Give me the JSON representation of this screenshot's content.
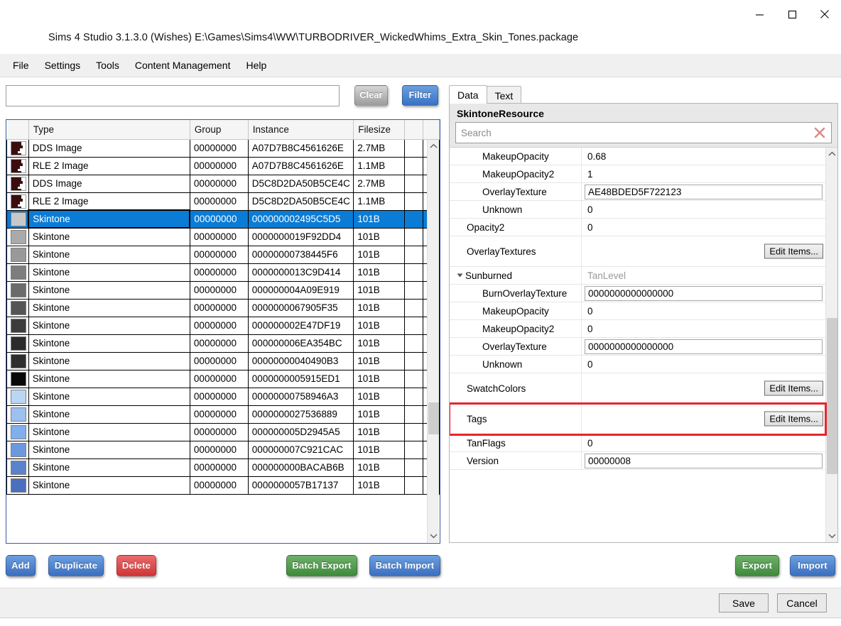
{
  "window": {
    "title": "Sims 4 Studio 3.1.3.0 (Wishes)  E:\\Games\\Sims4\\WW\\TURBODRIVER_WickedWhims_Extra_Skin_Tones.package",
    "minimize_label": "Minimize",
    "maximize_label": "Maximize",
    "close_label": "Close"
  },
  "menu": {
    "items": [
      {
        "label": "File"
      },
      {
        "label": "Settings"
      },
      {
        "label": "Tools"
      },
      {
        "label": "Content Management"
      },
      {
        "label": "Help"
      }
    ]
  },
  "filter": {
    "input_value": "",
    "input_placeholder": "",
    "clear_label": "Clear",
    "filter_label": "Filter"
  },
  "resource_table": {
    "columns": [
      "",
      "Type",
      "Group",
      "Instance",
      "Filesize",
      "",
      ""
    ],
    "rows": [
      {
        "icon": "dds-thumb",
        "color": "#3b0d10",
        "type": "DDS Image",
        "group": "00000000",
        "instance": "A07D7B8C4561626E",
        "filesize": "2.7MB",
        "selected": false
      },
      {
        "icon": "dds-thumb",
        "color": "#3b0d10",
        "type": "RLE 2 Image",
        "group": "00000000",
        "instance": "A07D7B8C4561626E",
        "filesize": "1.1MB",
        "selected": false
      },
      {
        "icon": "dds-thumb",
        "color": "#3b0d10",
        "type": "DDS Image",
        "group": "00000000",
        "instance": "D5C8D2DA50B5CE4C",
        "filesize": "2.7MB",
        "selected": false
      },
      {
        "icon": "dds-thumb",
        "color": "#3b0d10",
        "type": "RLE 2 Image",
        "group": "00000000",
        "instance": "D5C8D2DA50B5CE4C",
        "filesize": "1.1MB",
        "selected": false
      },
      {
        "icon": "swatch",
        "color": "#c8c8c8",
        "type": "Skintone",
        "group": "00000000",
        "instance": "000000002495C5D5",
        "filesize": "101B",
        "selected": true
      },
      {
        "icon": "swatch",
        "color": "#aaaaaa",
        "type": "Skintone",
        "group": "00000000",
        "instance": "0000000019F92DD4",
        "filesize": "101B",
        "selected": false
      },
      {
        "icon": "swatch",
        "color": "#999999",
        "type": "Skintone",
        "group": "00000000",
        "instance": "00000000738445F6",
        "filesize": "101B",
        "selected": false
      },
      {
        "icon": "swatch",
        "color": "#7d7d7d",
        "type": "Skintone",
        "group": "00000000",
        "instance": "0000000013C9D414",
        "filesize": "101B",
        "selected": false
      },
      {
        "icon": "swatch",
        "color": "#6b6b6b",
        "type": "Skintone",
        "group": "00000000",
        "instance": "000000004A09E919",
        "filesize": "101B",
        "selected": false
      },
      {
        "icon": "swatch",
        "color": "#555555",
        "type": "Skintone",
        "group": "00000000",
        "instance": "0000000067905F35",
        "filesize": "101B",
        "selected": false
      },
      {
        "icon": "swatch",
        "color": "#3c3c3c",
        "type": "Skintone",
        "group": "00000000",
        "instance": "000000002E47DF19",
        "filesize": "101B",
        "selected": false
      },
      {
        "icon": "swatch",
        "color": "#2b2b2b",
        "type": "Skintone",
        "group": "00000000",
        "instance": "000000006EA354BC",
        "filesize": "101B",
        "selected": false
      },
      {
        "icon": "swatch",
        "color": "#2e2e2e",
        "type": "Skintone",
        "group": "00000000",
        "instance": "00000000040490B3",
        "filesize": "101B",
        "selected": false
      },
      {
        "icon": "swatch",
        "color": "#080808",
        "type": "Skintone",
        "group": "00000000",
        "instance": "0000000005915ED1",
        "filesize": "101B",
        "selected": false
      },
      {
        "icon": "swatch",
        "color": "#bbd6f5",
        "type": "Skintone",
        "group": "00000000",
        "instance": "00000000758946A3",
        "filesize": "101B",
        "selected": false
      },
      {
        "icon": "swatch",
        "color": "#9cc0ef",
        "type": "Skintone",
        "group": "00000000",
        "instance": "0000000027536889",
        "filesize": "101B",
        "selected": false
      },
      {
        "icon": "swatch",
        "color": "#82aeec",
        "type": "Skintone",
        "group": "00000000",
        "instance": "000000005D2945A5",
        "filesize": "101B",
        "selected": false
      },
      {
        "icon": "swatch",
        "color": "#6c98de",
        "type": "Skintone",
        "group": "00000000",
        "instance": "000000007C921CAC",
        "filesize": "101B",
        "selected": false
      },
      {
        "icon": "swatch",
        "color": "#5a82cd",
        "type": "Skintone",
        "group": "00000000",
        "instance": "000000000BACAB6B",
        "filesize": "101B",
        "selected": false
      },
      {
        "icon": "swatch",
        "color": "#4a6fbe",
        "type": "Skintone",
        "group": "00000000",
        "instance": "0000000057B17137",
        "filesize": "101B",
        "selected": false
      }
    ]
  },
  "details": {
    "tabs": [
      {
        "label": "Data",
        "active": true
      },
      {
        "label": "Text",
        "active": false
      }
    ],
    "resource_title": "SkintoneResource",
    "search": {
      "value": "",
      "placeholder": "Search",
      "clear_icon": "clear-x-icon"
    },
    "edit_items_label": "Edit Items...",
    "properties": [
      {
        "name": "MakeupOpacity",
        "indent": 2,
        "value": "0.68",
        "kind": "text"
      },
      {
        "name": "MakeupOpacity2",
        "indent": 2,
        "value": "1",
        "kind": "text"
      },
      {
        "name": "OverlayTexture",
        "indent": 2,
        "value": "AE48BDED5F722123",
        "kind": "input"
      },
      {
        "name": "Unknown",
        "indent": 2,
        "value": "0",
        "kind": "text"
      },
      {
        "name": "Opacity2",
        "indent": 1,
        "value": "0",
        "kind": "text"
      },
      {
        "name": "OverlayTextures",
        "indent": 1,
        "value": "",
        "kind": "button",
        "tall": true
      },
      {
        "name": "Sunburned",
        "indent": 1,
        "value": "TanLevel",
        "kind": "grey",
        "expander": true
      },
      {
        "name": "BurnOverlayTexture",
        "indent": 2,
        "value": "0000000000000000",
        "kind": "input"
      },
      {
        "name": "MakeupOpacity",
        "indent": 2,
        "value": "0",
        "kind": "text"
      },
      {
        "name": "MakeupOpacity2",
        "indent": 2,
        "value": "0",
        "kind": "text"
      },
      {
        "name": "OverlayTexture",
        "indent": 2,
        "value": "0000000000000000",
        "kind": "input"
      },
      {
        "name": "Unknown",
        "indent": 2,
        "value": "0",
        "kind": "text"
      },
      {
        "name": "SwatchColors",
        "indent": 1,
        "value": "",
        "kind": "button",
        "tall": true
      },
      {
        "name": "Tags",
        "indent": 1,
        "value": "",
        "kind": "button",
        "tall": true,
        "highlighted": true
      },
      {
        "name": "TanFlags",
        "indent": 1,
        "value": "0",
        "kind": "text"
      },
      {
        "name": "Version",
        "indent": 1,
        "value": "00000008",
        "kind": "input"
      }
    ]
  },
  "actions": {
    "add_label": "Add",
    "duplicate_label": "Duplicate",
    "delete_label": "Delete",
    "batch_export_label": "Batch Export",
    "batch_import_label": "Batch Import",
    "export_label": "Export",
    "import_label": "Import"
  },
  "statusbar": {
    "save_label": "Save",
    "cancel_label": "Cancel"
  },
  "colors": {
    "selection_blue": "#0a7cd6",
    "accent_blue": "#3b6fc0",
    "accent_green": "#3f8a3c",
    "accent_red": "#cf3535",
    "highlight_red": "#e8242a"
  }
}
